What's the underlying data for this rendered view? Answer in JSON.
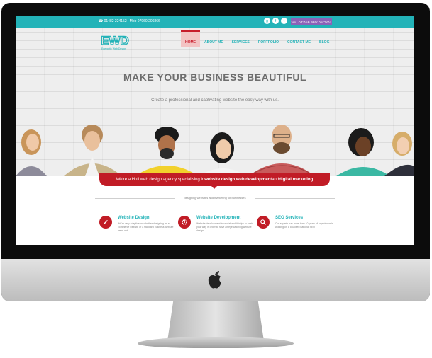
{
  "topbar": {
    "contact": "☎ 01482 224152 | Mob 07960 206866",
    "cta_label": "GET A FREE SEO REPORT",
    "social_icons": [
      "google-plus-icon",
      "facebook-icon",
      "twitter-icon"
    ]
  },
  "brand": {
    "logo_text": "EWD",
    "logo_subtext": "Energetic Web Design"
  },
  "nav": {
    "items": [
      "HOME",
      "ABOUT ME",
      "SERVICES",
      "PORTFOLIO",
      "CONTACT ME",
      "BLOG"
    ],
    "active": "HOME"
  },
  "hero": {
    "headline": "MAKE YOUR BUSINESS BEAUTIFUL",
    "tagline": "Create a professional and captivating website the easy way with us."
  },
  "banner": {
    "text_before": "We're a Hull web design agency specialising in ",
    "strong_1": "website design",
    "sep_1": ", ",
    "strong_2": "web development",
    "sep_2": " and ",
    "strong_3": "digital marketing"
  },
  "divider": {
    "text": "designing websites and marketing for businesses"
  },
  "services": [
    {
      "title": "Website Design",
      "text": "We're very adaptive on whether designing an e-commerce website or a standard business website we're not...",
      "icon": "pencil-icon"
    },
    {
      "title": "Website Development",
      "text": "Website development is crucial and it helps to work your way in order to have an eye catching website design...",
      "icon": "gear-icon"
    },
    {
      "title": "SEO Services",
      "text": "Our experts has more than 10 years of experience in working on a localised national SEO",
      "icon": "search-icon"
    }
  ],
  "colors": {
    "teal": "#23b3b8",
    "red": "#c11c26",
    "purple": "#8b62b8"
  }
}
